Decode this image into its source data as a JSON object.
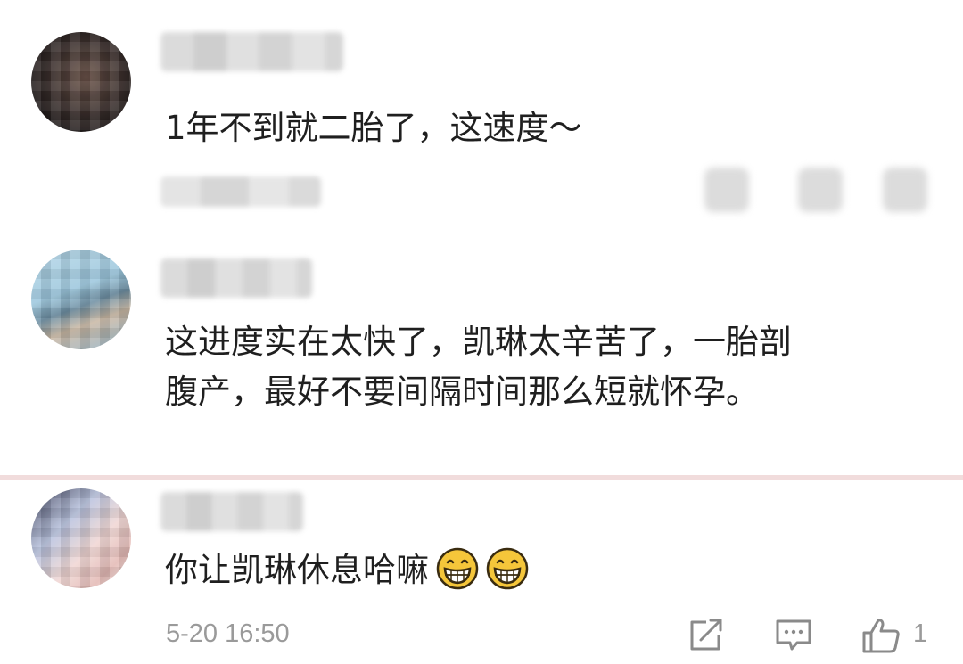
{
  "comments": [
    {
      "text": "1年不到就二胎了，这速度～"
    },
    {
      "text_line1": "这进度实在太快了，凯琳太辛苦了，一胎剖",
      "text_line2": "腹产，最好不要间隔时间那么短就怀孕。"
    },
    {
      "text": "你让凯琳休息哈嘛",
      "emoji": [
        "grin-emoji",
        "grin-emoji"
      ],
      "time": "5-20 16:50",
      "likes": "1"
    }
  ],
  "icons": {
    "share": "share-icon",
    "comment": "comment-icon",
    "like": "thumbs-up-icon"
  },
  "colors": {
    "text": "#1f1f1f",
    "meta": "#9a9a9a",
    "divider": "#f1dcdc",
    "emoji": "#f5c63a"
  }
}
